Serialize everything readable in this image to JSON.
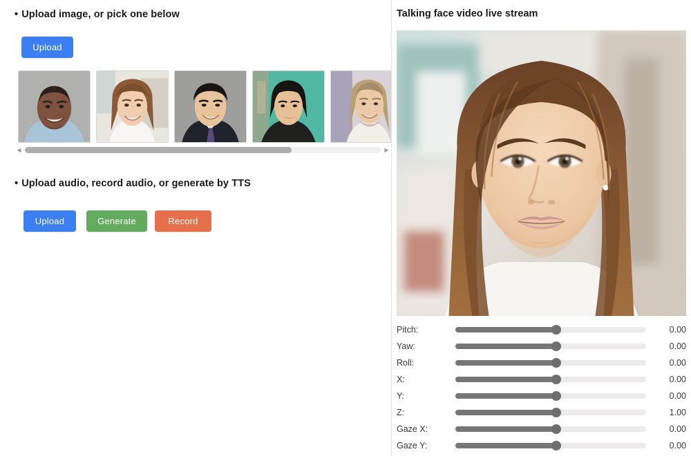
{
  "left": {
    "image_section": {
      "bullet": "•",
      "heading": "Upload image, or pick one below",
      "upload_label": "Upload",
      "thumbnails": [
        {
          "name": "thumbnail-man-smiling-gray",
          "alt": "Smiling man, gray background, light blue shirt"
        },
        {
          "name": "thumbnail-woman-long-brown-hair",
          "alt": "Smiling woman with long brown hair, bright background"
        },
        {
          "name": "thumbnail-man-suit-tie",
          "alt": "Man in dark suit with white shirt and tie, gray background"
        },
        {
          "name": "thumbnail-woman-teal-background",
          "alt": "Woman with short dark hair, teal background"
        },
        {
          "name": "thumbnail-man-long-blond-hair",
          "alt": "Man with long blond hair, partially visible"
        }
      ],
      "scrollbar": {
        "left_arrow": "◀",
        "right_arrow": "▶",
        "thumb_percent": 75
      }
    },
    "audio_section": {
      "bullet": "•",
      "heading": "Upload audio, record audio, or generate by TTS",
      "buttons": [
        {
          "label": "Upload",
          "color": "#3b7ff2",
          "name": "audio-upload-button"
        },
        {
          "label": "Generate",
          "color": "#63ab5e",
          "name": "audio-generate-button"
        },
        {
          "label": "Record",
          "color": "#e5704b",
          "name": "audio-record-button"
        }
      ]
    }
  },
  "right": {
    "stream_title": "Talking face video live stream",
    "video": {
      "alt": "Live stream of a woman with long brown hair facing camera, blurred indoor background"
    },
    "sliders": [
      {
        "label": "Pitch:",
        "value": "0.00",
        "percent": 53,
        "name": "slider-pitch"
      },
      {
        "label": "Yaw:",
        "value": "0.00",
        "percent": 53,
        "name": "slider-yaw"
      },
      {
        "label": "Roll:",
        "value": "0.00",
        "percent": 53,
        "name": "slider-roll"
      },
      {
        "label": "X:",
        "value": "0.00",
        "percent": 53,
        "name": "slider-x"
      },
      {
        "label": "Y:",
        "value": "0.00",
        "percent": 53,
        "name": "slider-y"
      },
      {
        "label": "Z:",
        "value": "1.00",
        "percent": 53,
        "name": "slider-z"
      },
      {
        "label": "Gaze X:",
        "value": "0.00",
        "percent": 53,
        "name": "slider-gaze-x"
      },
      {
        "label": "Gaze Y:",
        "value": "0.00",
        "percent": 53,
        "name": "slider-gaze-y"
      }
    ]
  }
}
